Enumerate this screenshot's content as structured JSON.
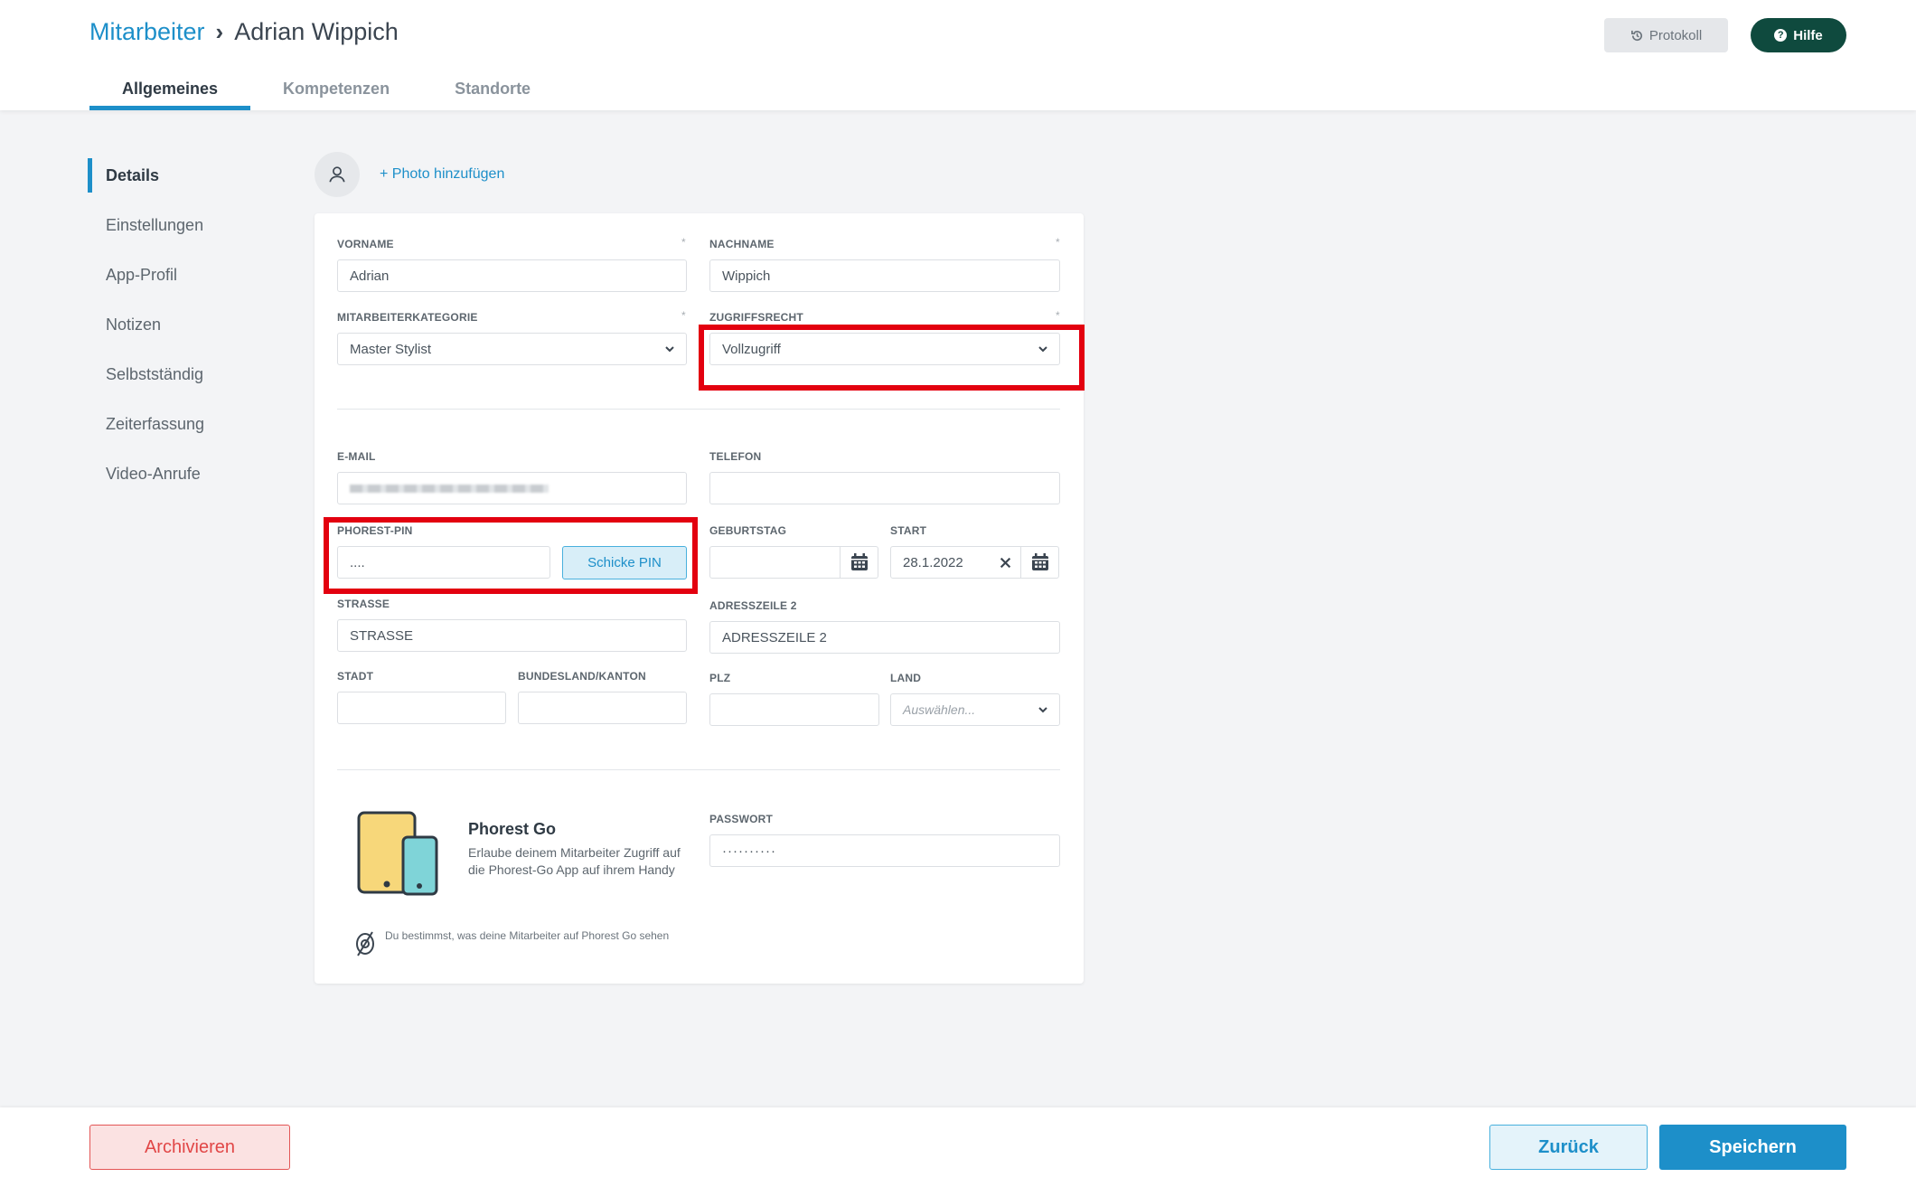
{
  "header": {
    "breadcrumb_link": "Mitarbeiter",
    "breadcrumb_current": "Adrian Wippich",
    "tabs": [
      {
        "label": "Allgemeines"
      },
      {
        "label": "Kompetenzen"
      },
      {
        "label": "Standorte"
      }
    ],
    "protokoll_label": "Protokoll",
    "hilfe_label": "Hilfe"
  },
  "sidebar": {
    "items": [
      {
        "label": "Details"
      },
      {
        "label": "Einstellungen"
      },
      {
        "label": "App-Profil"
      },
      {
        "label": "Notizen"
      },
      {
        "label": "Selbstständig"
      },
      {
        "label": "Zeiterfassung"
      },
      {
        "label": "Video-Anrufe"
      }
    ]
  },
  "photo": {
    "add_label": "+ Photo hinzufügen"
  },
  "form": {
    "vorname": {
      "label": "VORNAME",
      "value": "Adrian"
    },
    "nachname": {
      "label": "NACHNAME",
      "value": "Wippich"
    },
    "kategorie": {
      "label": "MITARBEITERKATEGORIE",
      "value": "Master Stylist"
    },
    "zugriffsrecht": {
      "label": "ZUGRIFFSRECHT",
      "value": "Vollzugriff"
    },
    "email": {
      "label": "E-MAIL"
    },
    "telefon": {
      "label": "TELEFON",
      "value": ""
    },
    "pin": {
      "label": "PHOREST-PIN",
      "value": "....",
      "button": "Schicke PIN"
    },
    "geburtstag": {
      "label": "GEBURTSTAG",
      "value": ""
    },
    "start": {
      "label": "START",
      "value": "28.1.2022"
    },
    "strasse": {
      "label": "STRASSE",
      "placeholder": "STRASSE"
    },
    "adresszeile2": {
      "label": "ADRESSZEILE 2",
      "placeholder": "ADRESSZEILE 2"
    },
    "stadt": {
      "label": "STADT",
      "value": ""
    },
    "bundesland": {
      "label": "BUNDESLAND/KANTON",
      "value": ""
    },
    "plz": {
      "label": "PLZ",
      "value": ""
    },
    "land": {
      "label": "LAND",
      "placeholder": "Auswählen..."
    },
    "passwort": {
      "label": "PASSWORT",
      "value": "··········"
    },
    "required_mark": "*"
  },
  "phorest_go": {
    "title": "Phorest Go",
    "description": "Erlaube deinem Mitarbeiter Zugriff auf die Phorest-Go App auf ihrem Handy",
    "note": "Du bestimmst, was deine Mitarbeiter auf Phorest Go sehen"
  },
  "footer": {
    "archive_label": "Archivieren",
    "back_label": "Zurück",
    "save_label": "Speichern"
  },
  "colors": {
    "accent": "#1d8fc9",
    "highlight": "#e3000f",
    "danger": "#e14646",
    "help_button": "#0f4a3e"
  }
}
